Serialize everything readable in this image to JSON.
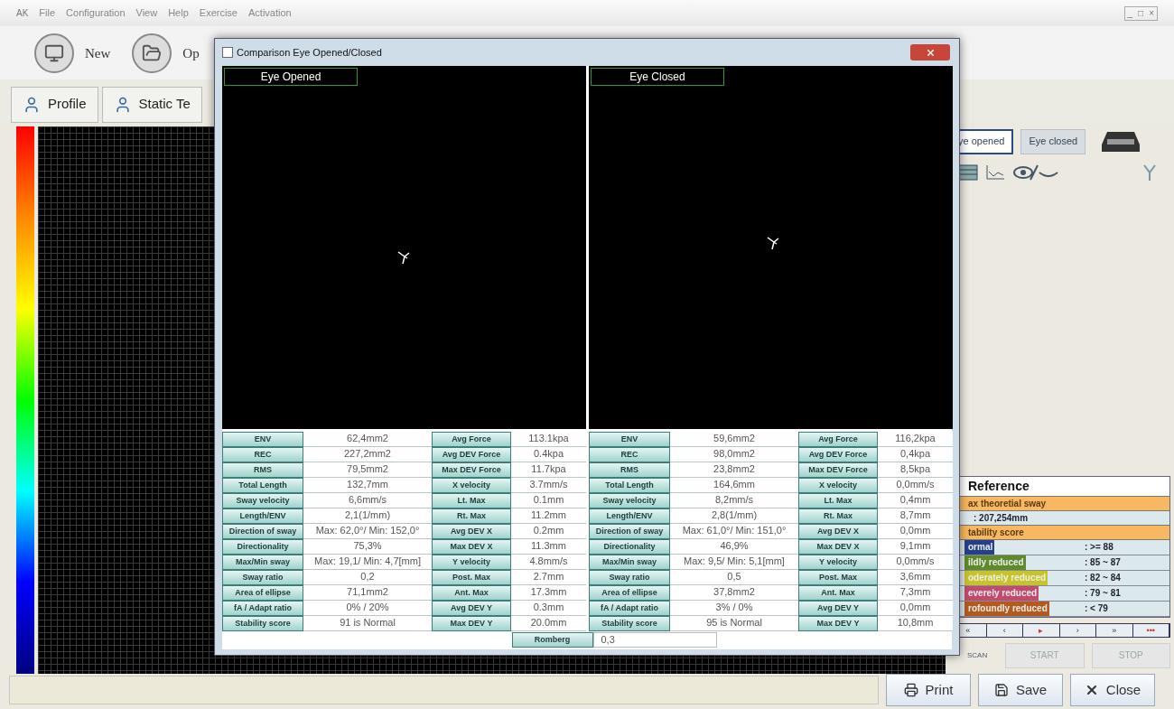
{
  "app_logo": "AK",
  "menu": [
    "File",
    "Configuration",
    "View",
    "Help",
    "Exercise",
    "Activation"
  ],
  "window_controls": [
    "_",
    "□",
    "×"
  ],
  "toolbar": [
    {
      "label": "New"
    },
    {
      "label": "Op"
    }
  ],
  "tabs": [
    {
      "label": "Profile"
    },
    {
      "label": "Static Te"
    }
  ],
  "eye_buttons": [
    {
      "label": "ye opened",
      "selected": true
    },
    {
      "label": "Eye closed",
      "selected": false
    }
  ],
  "reference": {
    "title": "Reference",
    "sway_label": "ax theoretial sway",
    "sway_value": ": 207,254mm",
    "score_label": "tability score",
    "levels": [
      {
        "name": "ormal",
        "range": ": >= 88",
        "color": "#24408a"
      },
      {
        "name": "ildly reduced",
        "range": ": 85 ~ 87",
        "color": "#5f8a2a"
      },
      {
        "name": "oderately reduced",
        "range": ": 82 ~ 84",
        "color": "#c6c42a"
      },
      {
        "name": "everely reduced",
        "range": ": 79 ~ 81",
        "color": "#c24a6a"
      },
      {
        "name": "rofoundly reduced",
        "range": ": < 79",
        "color": "#b35a1e"
      }
    ]
  },
  "nav_buttons": [
    "«",
    "‹",
    "▸",
    "›",
    "»",
    "•••"
  ],
  "scan": {
    "label": "SCAN",
    "buttons": [
      {
        "label": "START",
        "disabled": true
      },
      {
        "label": "STOP",
        "disabled": true
      }
    ]
  },
  "bottom_buttons": [
    {
      "label": "Print",
      "kind": "print"
    },
    {
      "label": "Save",
      "kind": "save"
    },
    {
      "label": "Close",
      "kind": "close"
    }
  ],
  "dialog": {
    "title": "Comparison Eye Opened/Closed",
    "panels": [
      {
        "label": "Eye Opened",
        "rows": [
          [
            "ENV",
            "62,4mm2",
            "Avg Force",
            "113.1kpa"
          ],
          [
            "REC",
            "227,2mm2",
            "Avg DEV Force",
            "0.4kpa"
          ],
          [
            "RMS",
            "79,5mm2",
            "Max DEV Force",
            "11.7kpa"
          ],
          [
            "Total Length",
            "132,7mm",
            "X velocity",
            "3.7mm/s"
          ],
          [
            "Sway velocity",
            "6,6mm/s",
            "Lt. Max",
            "0.1mm"
          ],
          [
            "Length/ENV",
            "2,1(1/mm)",
            "Rt. Max",
            "11.2mm"
          ],
          [
            "Direction of sway",
            "Max: 62,0°/ Min: 152,0°",
            "Avg DEV X",
            "0.2mm"
          ],
          [
            "Directionality",
            "75,3%",
            "Max DEV X",
            "11.3mm"
          ],
          [
            "Max/Min sway",
            "Max: 19,1/ Min: 4,7[mm]",
            "Y velocity",
            "4.8mm/s"
          ],
          [
            "Sway ratio",
            "0,2",
            "Post. Max",
            "2.7mm"
          ],
          [
            "Area of ellipse",
            "71,1mm2",
            "Ant. Max",
            "17.3mm"
          ],
          [
            "fA / Adapt ratio",
            "0%  /  20%",
            "Avg DEV Y",
            "0.3mm"
          ],
          [
            "Stability score",
            "91 is Normal",
            "Max DEV Y",
            "20.0mm"
          ]
        ]
      },
      {
        "label": "Eye Closed",
        "rows": [
          [
            "ENV",
            "59,6mm2",
            "Avg Force",
            "116,2kpa"
          ],
          [
            "REC",
            "98,0mm2",
            "Avg DEV Force",
            "0,4kpa"
          ],
          [
            "RMS",
            "23,8mm2",
            "Max DEV Force",
            "8,5kpa"
          ],
          [
            "Total Length",
            "164,6mm",
            "X velocity",
            "0,0mm/s"
          ],
          [
            "Sway velocity",
            "8,2mm/s",
            "Lt. Max",
            "0,4mm"
          ],
          [
            "Length/ENV",
            "2,8(1/mm)",
            "Rt. Max",
            "8,7mm"
          ],
          [
            "Direction of sway",
            "Max: 61,0°/ Min: 151,0°",
            "Avg DEV X",
            "0,0mm"
          ],
          [
            "Directionality",
            "46,9%",
            "Max DEV X",
            "9,1mm"
          ],
          [
            "Max/Min sway",
            "Max: 9,5/ Min: 5,1[mm]",
            "Y velocity",
            "0,0mm/s"
          ],
          [
            "Sway ratio",
            "0,5",
            "Post. Max",
            "3,6mm"
          ],
          [
            "Area of ellipse",
            "37,8mm2",
            "Ant. Max",
            "7,3mm"
          ],
          [
            "fA / Adapt ratio",
            "3%  /  0%",
            "Avg DEV Y",
            "0,0mm"
          ],
          [
            "Stability score",
            "95 is Normal",
            "Max DEV Y",
            "10,8mm"
          ]
        ]
      }
    ],
    "romberg": {
      "label": "Romberg",
      "value": "0,3"
    }
  }
}
